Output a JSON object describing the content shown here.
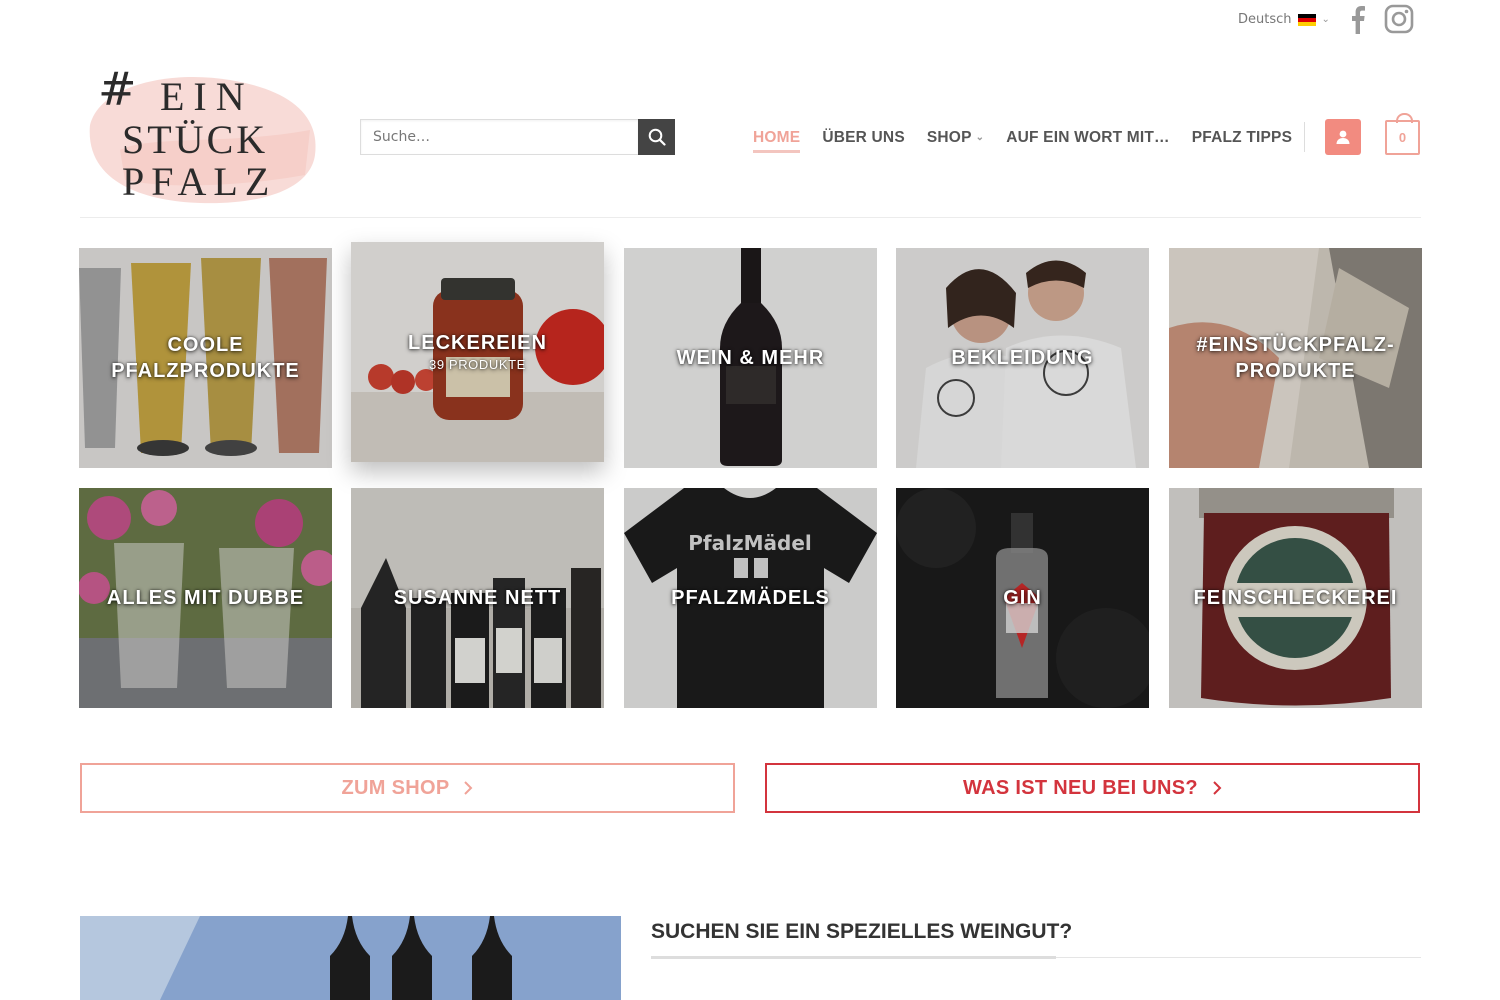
{
  "topbar": {
    "language": "Deutsch",
    "icons": [
      "flag-de-icon",
      "facebook-icon",
      "instagram-icon"
    ]
  },
  "header": {
    "logo_line1": "EIN",
    "logo_line2": "STÜCK",
    "logo_line3": "PFALZ",
    "search_placeholder": "Suche…",
    "nav": [
      {
        "label": "HOME",
        "active": true
      },
      {
        "label": "ÜBER UNS"
      },
      {
        "label": "SHOP",
        "dropdown": true
      },
      {
        "label": "AUF EIN WORT MIT…"
      },
      {
        "label": "PFALZ TIPPS"
      }
    ],
    "cart_count": "0"
  },
  "categories": [
    {
      "title": "COOLE PFALZPRODUKTE"
    },
    {
      "title": "LECKEREIEN",
      "count": "39 PRODUKTE"
    },
    {
      "title": "WEIN & MEHR"
    },
    {
      "title": "BEKLEIDUNG"
    },
    {
      "title": "#EINSTÜCKPFALZ-PRODUKTE"
    },
    {
      "title": "ALLES MIT DUBBE"
    },
    {
      "title": "SUSANNE NETT"
    },
    {
      "title": "PFALZMÄDELS"
    },
    {
      "title": "GIN"
    },
    {
      "title": "FEINSCHLECKEREI"
    }
  ],
  "buttons": {
    "shop": "ZUM SHOP",
    "new": "WAS IST NEU BEI UNS?"
  },
  "section": {
    "heading": "SUCHEN SIE EIN SPEZIELLES WEINGUT?"
  },
  "colors": {
    "accent_pink": "#f0a398",
    "accent_red": "#d3343d",
    "account_btn": "#f28b80",
    "text_dark": "#555555"
  }
}
